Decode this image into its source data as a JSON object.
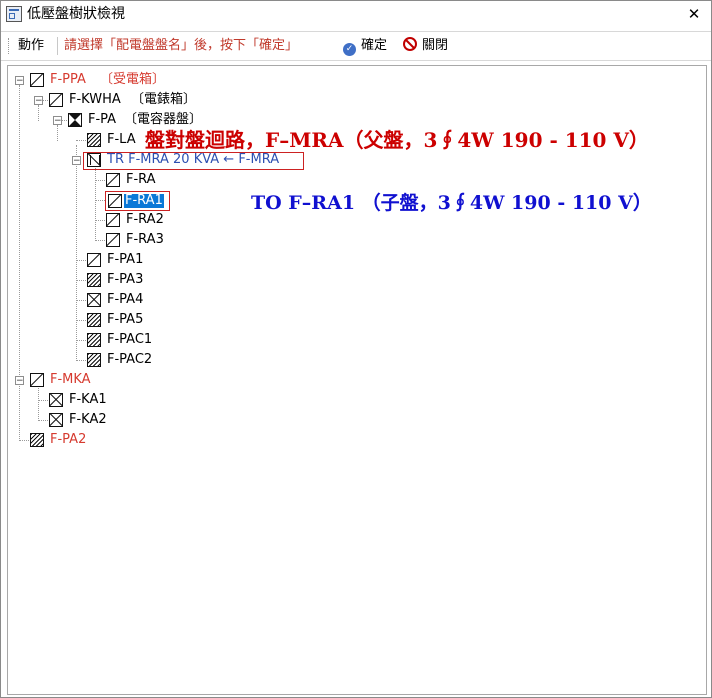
{
  "window": {
    "title": "低壓盤樹狀檢視",
    "close_glyph": "✕"
  },
  "toolbar": {
    "action_label": "動作",
    "hint": "請選擇「配電盤盤名」後，按下「確定」",
    "confirm_label": "確定",
    "close_label": "關閉"
  },
  "tree": {
    "nodes": [
      {
        "label": "F-PPA",
        "suffix": "〔受電箱〕",
        "color": "#d63a2f"
      },
      {
        "label": "F-KWHA",
        "suffix": "〔電錶箱〕"
      },
      {
        "label": "F-PA",
        "suffix": "〔電容器盤〕"
      },
      {
        "label": "F-LA"
      },
      {
        "label": "TR F-MRA  20 KVA ← F-MRA",
        "color": "#2d4fb0"
      },
      {
        "label": "F-RA"
      },
      {
        "label": "F-RA1",
        "selected": true
      },
      {
        "label": "F-RA2"
      },
      {
        "label": "F-RA3"
      },
      {
        "label": "F-PA1"
      },
      {
        "label": "F-PA3"
      },
      {
        "label": "F-PA4"
      },
      {
        "label": "F-PA5"
      },
      {
        "label": "F-PAC1"
      },
      {
        "label": "F-PAC2"
      },
      {
        "label": "F-MKA",
        "color": "#d63a2f"
      },
      {
        "label": "F-KA1"
      },
      {
        "label": "F-KA2"
      },
      {
        "label": "F-PA2",
        "color": "#d63a2f"
      }
    ]
  },
  "annotations": {
    "red": "盤對盤迴路，F–MRA（父盤，3∮4W 190 - 110 V）",
    "blue": "TO  F–RA1 （子盤，3∮4W 190 - 110 V）"
  },
  "colors": {
    "hint_red": "#c0392b",
    "node_red": "#d63a2f",
    "node_blue": "#2d4fb0",
    "selection": "#0a78d7",
    "annotation_red": "#cc0000",
    "annotation_blue": "#1010d0"
  },
  "icons": [
    "app-icon",
    "close-icon",
    "confirm-check-icon",
    "close-ban-icon",
    "expand-icon",
    "node-icon"
  ]
}
